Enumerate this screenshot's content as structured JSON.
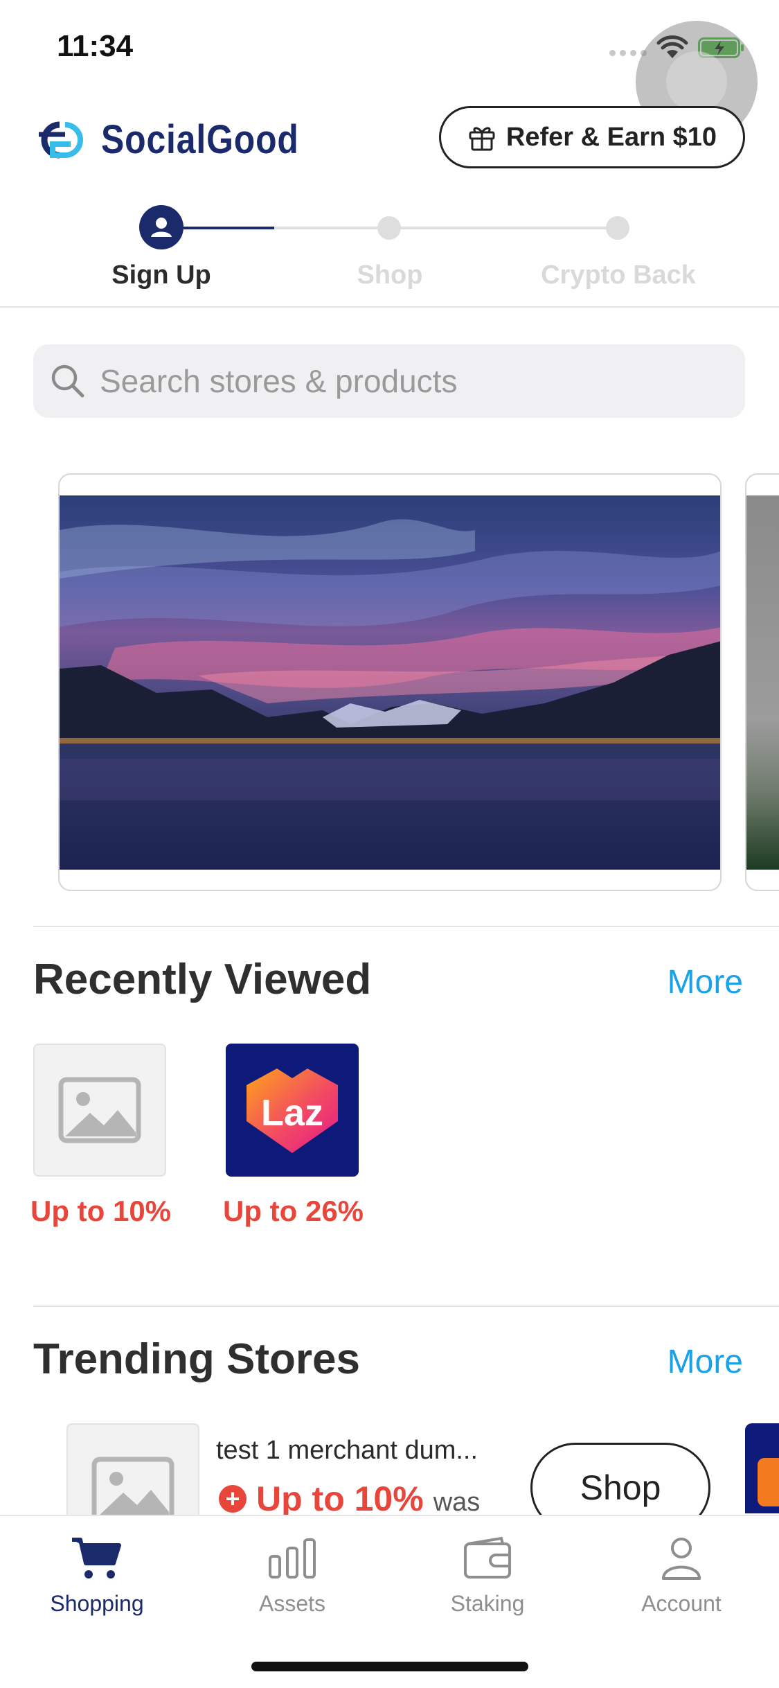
{
  "status_bar": {
    "time": "11:34"
  },
  "header": {
    "brand": "SocialGood",
    "refer_label": "Refer & Earn $10"
  },
  "stepper": {
    "steps": [
      {
        "label": "Sign Up",
        "active": true
      },
      {
        "label": "Shop",
        "active": false
      },
      {
        "label": "Crypto Back",
        "active": false
      }
    ]
  },
  "search": {
    "placeholder": "Search stores & products",
    "value": ""
  },
  "banner": {
    "description_icon": "landscape-photo"
  },
  "recently_viewed": {
    "title": "Recently Viewed",
    "more_label": "More",
    "items": [
      {
        "name": "placeholder-store",
        "cashback": "Up to 10%"
      },
      {
        "name": "Lazada",
        "logo_text": "Laz",
        "cashback": "Up to 26%"
      }
    ]
  },
  "trending_stores": {
    "title": "Trending Stores",
    "more_label": "More",
    "items": [
      {
        "name": "test 1 merchant dum...",
        "cashback": "Up to 10%",
        "was_label": "was",
        "shop_label": "Shop"
      }
    ]
  },
  "tab_bar": {
    "tabs": [
      {
        "label": "Shopping",
        "icon": "cart-icon",
        "active": true
      },
      {
        "label": "Assets",
        "icon": "bar-chart-icon",
        "active": false
      },
      {
        "label": "Staking",
        "icon": "wallet-icon",
        "active": false
      },
      {
        "label": "Account",
        "icon": "person-icon",
        "active": false
      }
    ]
  },
  "colors": {
    "brand_navy": "#1b2a6b",
    "accent_blue": "#1aa1e6",
    "cashback_red": "#e8463b"
  }
}
